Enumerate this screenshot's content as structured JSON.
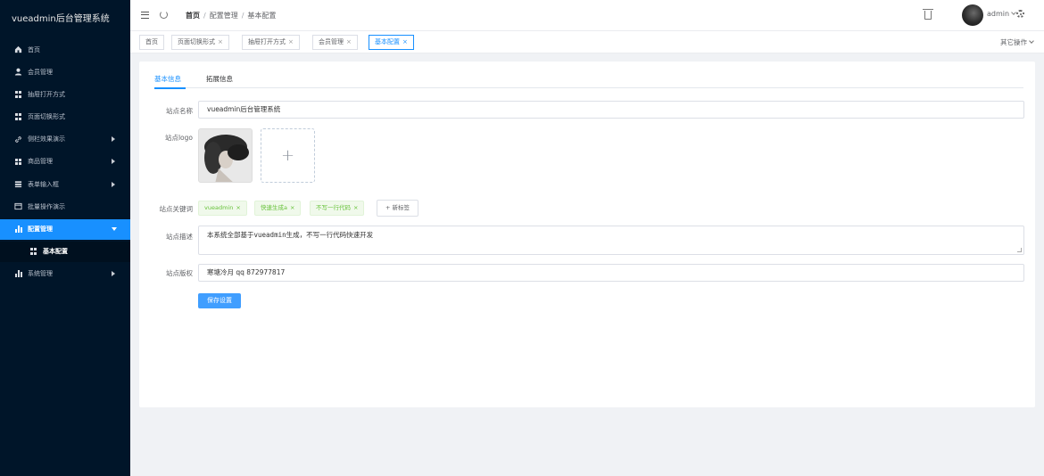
{
  "sidebar": {
    "brand": "vueadmin后台管理系统",
    "items": [
      {
        "label": "首页",
        "icon": "home-icon"
      },
      {
        "label": "会员管理",
        "icon": "user-icon"
      },
      {
        "label": "抽屉打开方式",
        "icon": "grid-icon"
      },
      {
        "label": "页面切换形式",
        "icon": "grid-icon"
      },
      {
        "label": "侧栏效果演示",
        "icon": "link-icon"
      },
      {
        "label": "商品管理",
        "icon": "grid-icon"
      },
      {
        "label": "表单输入框",
        "icon": "stack-icon"
      },
      {
        "label": "批量操作演示",
        "icon": "window-icon"
      },
      {
        "label": "配置管理",
        "icon": "bar-chart-icon"
      },
      {
        "label": "基本配置",
        "icon": "grid-icon"
      },
      {
        "label": "系统管理",
        "icon": "bar-chart-icon"
      }
    ]
  },
  "header": {
    "breadcrumb": [
      "首页",
      "配置管理",
      "基本配置"
    ],
    "breadcrumb_sep": "/",
    "user": "admin"
  },
  "tags": {
    "items": [
      "首页",
      "页面切换形式",
      "抽屉打开方式",
      "会员管理",
      "基本配置"
    ],
    "close_symbol": "×",
    "other_ops": "其它操作"
  },
  "form": {
    "tabs": [
      "基本信息",
      "拓展信息"
    ],
    "site_name_label": "站点名称",
    "site_name_value": "vueadmin后台管理系统",
    "site_logo_label": "站点logo",
    "upload_plus": "+",
    "keywords_label": "站点关键词",
    "keywords": [
      "vueadmin",
      "快速生成a",
      "不写一行代码"
    ],
    "new_tag_label": "+ 新标签",
    "description_label": "站点描述",
    "description_value": "本系统全部基于vueadmin生成，不写一行代码快速开发",
    "copyright_label": "站点版权",
    "copyright_value": "寒塘冷月 qq 872977817",
    "save_label": "保存设置"
  },
  "colors": {
    "sidebar_bg": "#001529",
    "primary": "#1890ff",
    "success_tag": "#67c23a"
  }
}
